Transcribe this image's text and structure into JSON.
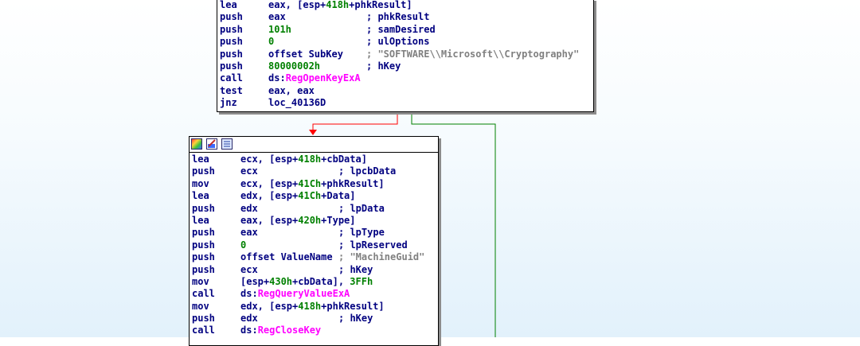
{
  "top_block": {
    "lines": [
      {
        "mn": "lea",
        "op": [
          {
            "t": "eax, [esp+",
            "k": "plain"
          },
          {
            "t": "418h",
            "k": "num"
          },
          {
            "t": "+phkResult]",
            "k": "plain"
          }
        ],
        "cm": []
      },
      {
        "mn": "push",
        "op": [
          {
            "t": "eax",
            "k": "plain"
          }
        ],
        "cm": [
          {
            "t": "; phkResult",
            "k": "cmt"
          }
        ]
      },
      {
        "mn": "push",
        "op": [
          {
            "t": "101h",
            "k": "num"
          }
        ],
        "cm": [
          {
            "t": "; samDesired",
            "k": "cmt"
          }
        ]
      },
      {
        "mn": "push",
        "op": [
          {
            "t": "0",
            "k": "num"
          }
        ],
        "cm": [
          {
            "t": "; ulOptions",
            "k": "cmt"
          }
        ]
      },
      {
        "mn": "push",
        "op": [
          {
            "t": "offset SubKey",
            "k": "plain"
          }
        ],
        "cm": [
          {
            "t": "; \"SOFTWARE\\\\Microsoft\\\\Cryptography\"",
            "k": "str"
          }
        ]
      },
      {
        "mn": "push",
        "op": [
          {
            "t": "80000002h",
            "k": "num"
          }
        ],
        "cm": [
          {
            "t": "; hKey",
            "k": "cmt"
          }
        ]
      },
      {
        "mn": "call",
        "op": [
          {
            "t": "ds:",
            "k": "plain"
          },
          {
            "t": "RegOpenKeyExA",
            "k": "fn"
          }
        ],
        "cm": []
      },
      {
        "mn": "test",
        "op": [
          {
            "t": "eax, eax",
            "k": "plain"
          }
        ],
        "cm": []
      },
      {
        "mn": "jnz",
        "op": [
          {
            "t": "loc_40136D",
            "k": "plain"
          }
        ],
        "cm": []
      }
    ]
  },
  "bottom_block": {
    "header_icons": [
      "graph-color-icon",
      "edit-node-icon",
      "node-text-icon"
    ],
    "lines": [
      {
        "mn": "lea",
        "op": [
          {
            "t": "ecx, [esp+",
            "k": "plain"
          },
          {
            "t": "418h",
            "k": "num"
          },
          {
            "t": "+cbData]",
            "k": "plain"
          }
        ],
        "cm": []
      },
      {
        "mn": "push",
        "op": [
          {
            "t": "ecx",
            "k": "plain"
          }
        ],
        "cm": [
          {
            "t": "; lpcbData",
            "k": "cmt"
          }
        ]
      },
      {
        "mn": "mov",
        "op": [
          {
            "t": "ecx, [esp+",
            "k": "plain"
          },
          {
            "t": "41Ch",
            "k": "num"
          },
          {
            "t": "+phkResult]",
            "k": "plain"
          }
        ],
        "cm": []
      },
      {
        "mn": "lea",
        "op": [
          {
            "t": "edx, [esp+",
            "k": "plain"
          },
          {
            "t": "41Ch",
            "k": "num"
          },
          {
            "t": "+Data]",
            "k": "plain"
          }
        ],
        "cm": []
      },
      {
        "mn": "push",
        "op": [
          {
            "t": "edx",
            "k": "plain"
          }
        ],
        "cm": [
          {
            "t": "; lpData",
            "k": "cmt"
          }
        ]
      },
      {
        "mn": "lea",
        "op": [
          {
            "t": "eax, [esp+",
            "k": "plain"
          },
          {
            "t": "420h",
            "k": "num"
          },
          {
            "t": "+Type]",
            "k": "plain"
          }
        ],
        "cm": []
      },
      {
        "mn": "push",
        "op": [
          {
            "t": "eax",
            "k": "plain"
          }
        ],
        "cm": [
          {
            "t": "; lpType",
            "k": "cmt"
          }
        ]
      },
      {
        "mn": "push",
        "op": [
          {
            "t": "0",
            "k": "num"
          }
        ],
        "cm": [
          {
            "t": "; lpReserved",
            "k": "cmt"
          }
        ]
      },
      {
        "mn": "push",
        "op": [
          {
            "t": "offset ValueName",
            "k": "plain"
          }
        ],
        "cm": [
          {
            "t": "; \"MachineGuid\"",
            "k": "str"
          }
        ]
      },
      {
        "mn": "push",
        "op": [
          {
            "t": "ecx",
            "k": "plain"
          }
        ],
        "cm": [
          {
            "t": "; hKey",
            "k": "cmt"
          }
        ]
      },
      {
        "mn": "mov",
        "op": [
          {
            "t": "[esp+",
            "k": "plain"
          },
          {
            "t": "430h",
            "k": "num"
          },
          {
            "t": "+cbData], ",
            "k": "plain"
          },
          {
            "t": "3FFh",
            "k": "num"
          }
        ],
        "cm": []
      },
      {
        "mn": "call",
        "op": [
          {
            "t": "ds:",
            "k": "plain"
          },
          {
            "t": "RegQueryValueExA",
            "k": "fn"
          }
        ],
        "cm": []
      },
      {
        "mn": "mov",
        "op": [
          {
            "t": "edx, [esp+",
            "k": "plain"
          },
          {
            "t": "418h",
            "k": "num"
          },
          {
            "t": "+phkResult]",
            "k": "plain"
          }
        ],
        "cm": []
      },
      {
        "mn": "push",
        "op": [
          {
            "t": "edx",
            "k": "plain"
          }
        ],
        "cm": [
          {
            "t": "; hKey",
            "k": "cmt"
          }
        ]
      },
      {
        "mn": "call",
        "op": [
          {
            "t": "ds:",
            "k": "plain"
          },
          {
            "t": "RegCloseKey",
            "k": "fn"
          }
        ],
        "cm": []
      }
    ]
  },
  "edges": {
    "false_branch_color": "#ff0000",
    "true_branch_color": "#008000"
  }
}
